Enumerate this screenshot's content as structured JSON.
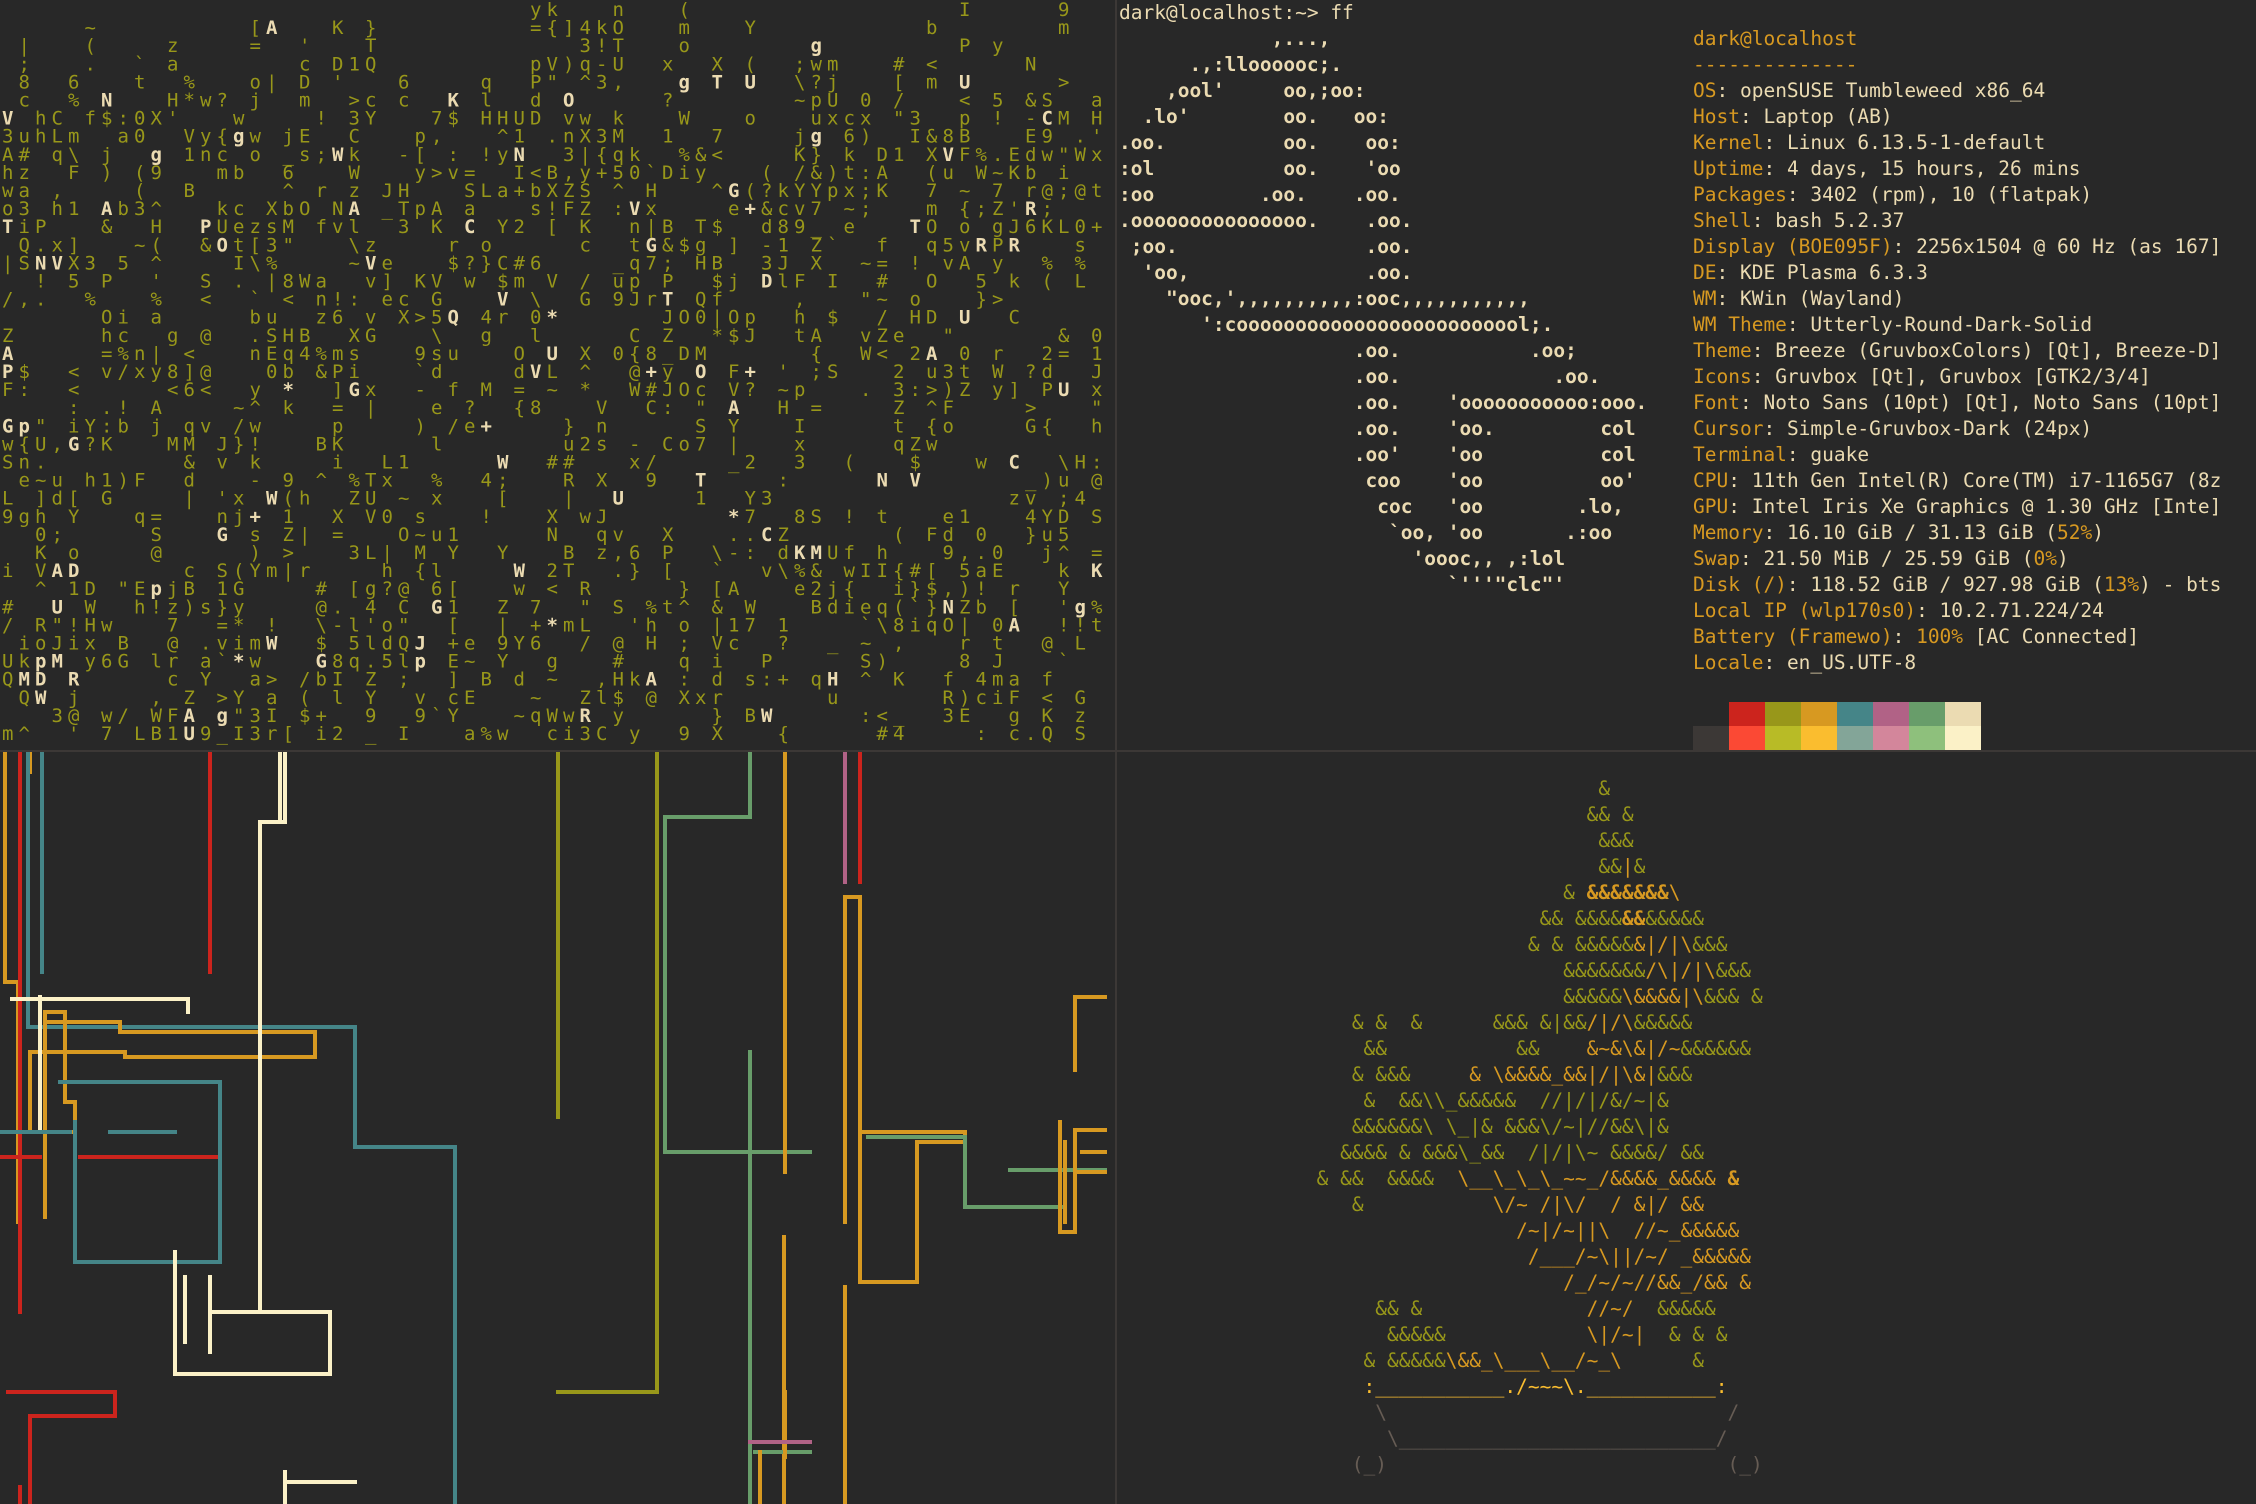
{
  "fastfetch": {
    "prompt": "dark@localhost:~> ff",
    "title": "dark@localhost",
    "separator": "--------------",
    "info": [
      {
        "key": "OS",
        "value": "openSUSE Tumbleweed x86_64"
      },
      {
        "key": "Host",
        "value": "Laptop (AB)"
      },
      {
        "key": "Kernel",
        "value": "Linux 6.13.5-1-default"
      },
      {
        "key": "Uptime",
        "value": "4 days, 15 hours, 26 mins"
      },
      {
        "key": "Packages",
        "value": "3402 (rpm), 10 (flatpak)"
      },
      {
        "key": "Shell",
        "value": "bash 5.2.37"
      },
      {
        "key": "Display (BOE095F)",
        "value": "2256x1504 @ 60 Hz (as 167]"
      },
      {
        "key": "DE",
        "value": "KDE Plasma 6.3.3"
      },
      {
        "key": "WM",
        "value": "KWin (Wayland)"
      },
      {
        "key": "WM Theme",
        "value": "Utterly-Round-Dark-Solid"
      },
      {
        "key": "Theme",
        "value": "Breeze (GruvboxColors) [Qt], Breeze-D]"
      },
      {
        "key": "Icons",
        "value": "Gruvbox [Qt], Gruvbox [GTK2/3/4]"
      },
      {
        "key": "Font",
        "value": "Noto Sans (10pt) [Qt], Noto Sans (10pt]"
      },
      {
        "key": "Cursor",
        "value": "Simple-Gruvbox-Dark (24px)"
      },
      {
        "key": "Terminal",
        "value": "guake"
      },
      {
        "key": "CPU",
        "value": "11th Gen Intel(R) Core(TM) i7-1165G7 (8z"
      },
      {
        "key": "GPU",
        "value": "Intel Iris Xe Graphics @ 1.30 GHz [Inte]"
      },
      {
        "key": "Memory",
        "value": "16.10 GiB / 31.13 GiB (",
        "highlight": "52%",
        "tail": ")"
      },
      {
        "key": "Swap",
        "value": "21.50 MiB / 25.59 GiB (",
        "highlight": "0%",
        "tail": ")"
      },
      {
        "key": "Disk (/)",
        "value": "118.52 GiB / 927.98 GiB (",
        "highlight": "13%",
        "tail": ") - bts"
      },
      {
        "key": "Local IP (wlp170s0)",
        "value": "10.2.71.224/24"
      },
      {
        "key": "Battery (Framewo)",
        "value": "",
        "highlight": "100%",
        "tail": " [AC Connected]"
      },
      {
        "key": "Locale",
        "value": "en_US.UTF-8"
      }
    ],
    "logo": [
      "             ,...,",
      "      .,:lloooooc;.",
      "    ,ool'     oo,;oo:",
      "  .lo'        oo.   oo:",
      ".oo.          oo.    oo:",
      ":ol           oo.    'oo",
      ":oo         .oo.    .oo.",
      ".ooooooooooooooo.    .oo.",
      " ;oo.                .oo.",
      "  'oo,               .oo.",
      "    \"ooc,',,,,,,,,,,:ooc,,,,,,,,,,,",
      "       ':cooooooooooooooooooooooool;.",
      "                    .oo.           .oo;",
      "                    .oo.             .oo.",
      "                    .oo.    'ooooooooooo:ooo.",
      "                    .oo.    'oo.         col",
      "                    .oo'    'oo          col",
      "                     coo    'oo          oo'",
      "                      coc   'oo        .lo,",
      "                       `oo, 'oo       .:oo",
      "                         'oooc,, ,:lol",
      "                            `'''\"clc\"'"
    ],
    "palette_top": [
      "#282828",
      "#cc241d",
      "#98971a",
      "#d79921",
      "#458588",
      "#b16286",
      "#689d6a",
      "#ebdbb2"
    ],
    "palette_bottom": [
      "#3c3836",
      "#fb4934",
      "#b8bb26",
      "#fabd2f",
      "#83a598",
      "#d3869b",
      "#8ec07c",
      "#fbf1c7"
    ]
  },
  "matrix": {
    "color_dim": "#98971a",
    "color_bright": "#ebdbb2",
    "columns": [
      {
        "c": 1,
        "r": 0,
        "t": "a  Q       O qHR,%9u'hRoUzdc<CT"
      },
      {
        "c": 3,
        "r": 0,
        "t": "4 O f`Q      WrJ:.I\\n.cJMcNKIJE"
      },
      {
        "c": 4,
        "r": 0,
        "t": "! f ,:sexyU>Q<*\\/!;a.9l9g,?1o&("
      },
      {
        "c": 5,
        "r": 0,
        "t": "q b ]KH*B&.i>WD\\\\G'TjF9cQ!?ny)"
      },
      {
        "c": 6,
        "r": 0,
        "t": "a 4 ,R2u- .zZ>D V D  QQxx   ]!AJe"
      },
      {
        "c": 8,
        "r": 0,
        "t": "8 &GkRR       !V0<&o<aIg?dsu"
      },
      {
        "c": 9,
        "r": 0,
        "t": "A  ,)R     b%b]P0etG oNw?NX_+@"
      },
      {
        "c": 10,
        "r": 0,
        "t": "J !g a  ++uWHDmHeNv @L!sk qYq"
      },
      {
        "c": 11,
        "r": 0,
        "t": "C l7vpr DcZw%P6I Q  !.( $ND\"C"
      },
      {
        "c": 12,
        "r": 0,
        "t": "# 6[ e9Y !Q#B=-t^vv+3Cv]k:s["
      },
      {
        "c": 14,
        "r": 0,
        "t": "     ejd  j W& 5i jrE G?  >lK"
      }
    ],
    "bright_chars": [
      "A",
      "W",
      "Q",
      "*",
      "O",
      "P",
      "R",
      "U",
      "M",
      "J",
      "+",
      "g",
      "N",
      "K",
      "G",
      "D",
      "H",
      "C",
      "V",
      "T",
      "p"
    ]
  },
  "bonsai": {
    "trunk_base": ":___________./~~~\\.___________:",
    "pot_left": "\\",
    "pot_right": "/",
    "feet": "(_)                             (_)"
  }
}
